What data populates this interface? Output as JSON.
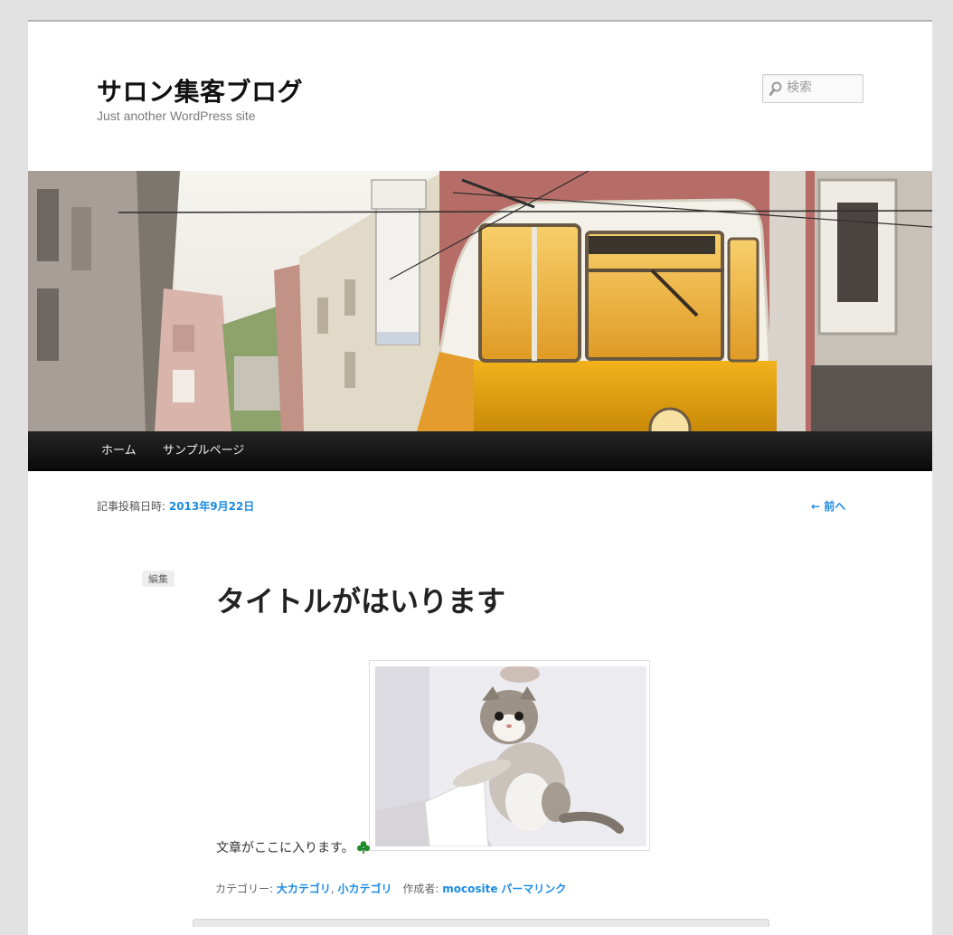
{
  "site": {
    "title": "サロン集客ブログ",
    "description": "Just another WordPress site"
  },
  "search": {
    "placeholder": "検索",
    "icon": "search-icon"
  },
  "nav": {
    "items": [
      {
        "label": "ホーム"
      },
      {
        "label": "サンプルページ"
      }
    ]
  },
  "post": {
    "meta_label": "記事投稿日時: ",
    "date": "2013年9月22日",
    "prev_link": "← 前へ",
    "edit_label": "編集",
    "title": "タイトルがはいります",
    "body_text": "文章がここに入ります。",
    "emoji_icon": "clover-icon",
    "footer": {
      "category_label": "カテゴリー: ",
      "categories": [
        "大カテゴリ",
        "小カテゴリ"
      ],
      "separator": ", ",
      "author_label": "作成者: ",
      "author": "mocosite",
      "permalink": "パーマリンク"
    }
  },
  "colors": {
    "link": "#1b8be0",
    "nav_bg": "#0a0a0a",
    "page_bg": "#e2e2e2"
  }
}
